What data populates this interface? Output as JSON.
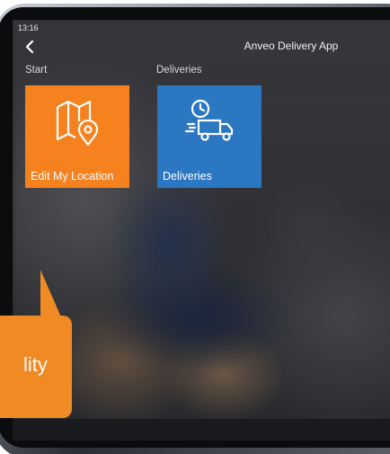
{
  "status_bar": {
    "time": "13:16"
  },
  "nav": {
    "title": "Anveo Delivery App"
  },
  "sections": [
    {
      "label": "Start"
    },
    {
      "label": "Deliveries"
    }
  ],
  "tiles": [
    {
      "label": "Edit My Location",
      "icon": "map-location-icon",
      "color": "#f5821f"
    },
    {
      "label": "Deliveries",
      "icon": "delivery-truck-clock-icon",
      "color": "#2b77c2"
    }
  ],
  "callout": {
    "text": "lity",
    "color": "#f08a24"
  }
}
